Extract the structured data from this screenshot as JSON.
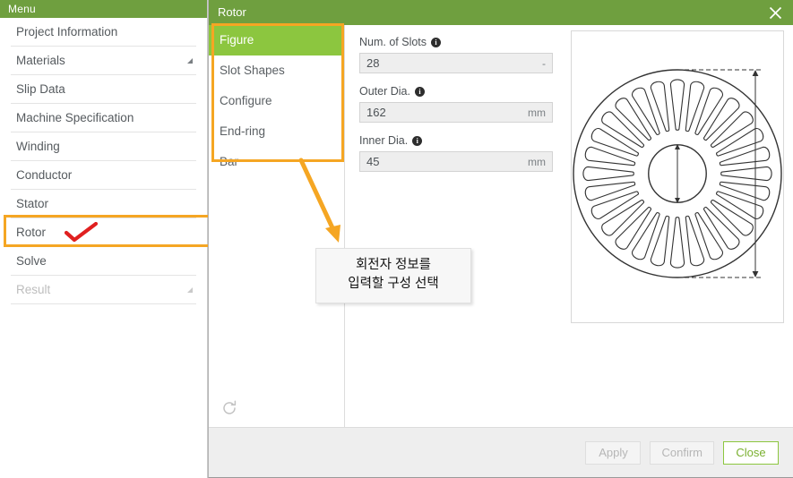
{
  "menu": {
    "title": "Menu",
    "items": [
      {
        "label": "Project Information",
        "disabled": false,
        "expandable": false
      },
      {
        "label": "Materials",
        "disabled": false,
        "expandable": true
      },
      {
        "label": "Slip Data",
        "disabled": false,
        "expandable": false
      },
      {
        "label": "Machine Specification",
        "disabled": false,
        "expandable": false
      },
      {
        "label": "Winding",
        "disabled": false,
        "expandable": false
      },
      {
        "label": "Conductor",
        "disabled": false,
        "expandable": false
      },
      {
        "label": "Stator",
        "disabled": false,
        "expandable": false
      },
      {
        "label": "Rotor",
        "disabled": false,
        "expandable": false
      },
      {
        "label": "Solve",
        "disabled": false,
        "expandable": false
      },
      {
        "label": "Result",
        "disabled": true,
        "expandable": true
      }
    ]
  },
  "dialog": {
    "title": "Rotor",
    "close_icon": "close-icon",
    "tabs": [
      {
        "label": "Figure",
        "active": true
      },
      {
        "label": "Slot Shapes",
        "active": false
      },
      {
        "label": "Configure",
        "active": false
      },
      {
        "label": "End-ring",
        "active": false
      },
      {
        "label": "Bar",
        "active": false
      }
    ],
    "refresh_icon": "refresh-icon",
    "fields": [
      {
        "label": "Num. of Slots",
        "value": "28",
        "unit": "-",
        "info_icon": "info-icon"
      },
      {
        "label": "Outer Dia.",
        "value": "162",
        "unit": "mm",
        "info_icon": "info-icon"
      },
      {
        "label": "Inner Dia.",
        "value": "45",
        "unit": "mm",
        "info_icon": "info-icon"
      }
    ],
    "figure": {
      "name": "rotor-lamination-diagram",
      "num_slots": 28,
      "outer_dia": 162,
      "inner_dia": 45
    },
    "footer": {
      "apply_label": "Apply",
      "confirm_label": "Confirm",
      "close_label": "Close"
    }
  },
  "annotation": {
    "text_line1": "회전자 정보를",
    "text_line2": "입력할 구성 선택",
    "highlight_color": "#f5a623",
    "check_color": "#e02020"
  },
  "colors": {
    "titlebar_green": "#6f9f3f",
    "active_tab_green": "#8cc63f",
    "highlight_orange": "#f5a623"
  }
}
